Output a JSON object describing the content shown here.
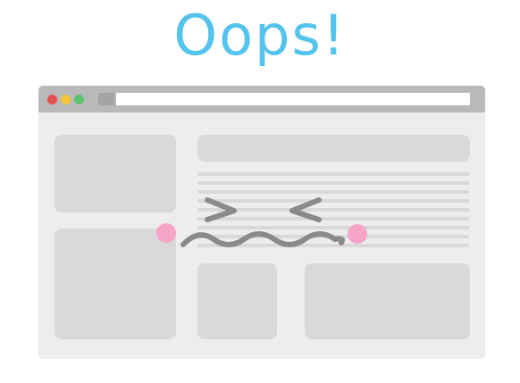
{
  "error_page": {
    "title": "Oops!"
  },
  "colors": {
    "title": "#55c4ec",
    "window_background": "#ededed",
    "titlebar": "#b9b9b9",
    "placeholder_block": "#d9d9d9",
    "close_dot": "#e6504f",
    "minimize_dot": "#f3c53b",
    "maximize_dot": "#5ec16b",
    "face_stroke": "#8a8a8a",
    "blush": "#f6a5c9"
  },
  "icons": {
    "close": "close-dot-icon",
    "minimize": "minimize-dot-icon",
    "maximize": "maximize-dot-icon",
    "face": "confused-face-icon"
  }
}
